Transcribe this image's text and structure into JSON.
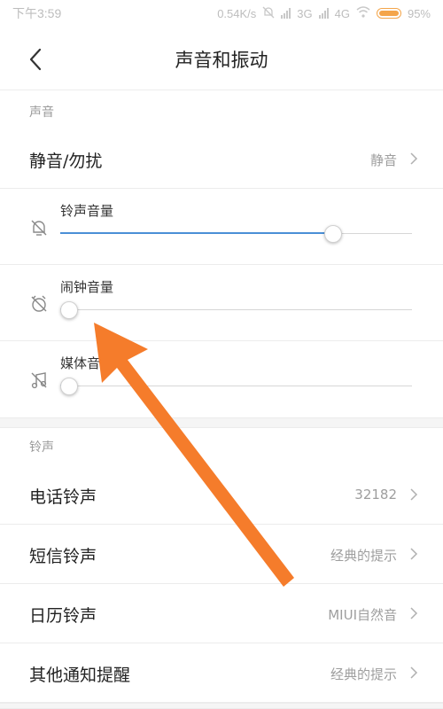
{
  "status_bar": {
    "time": "下午3:59",
    "network_speed": "0.54K/s",
    "network_3g": "3G",
    "network_4g": "4G",
    "battery": "95%",
    "icons": [
      "mute-icon",
      "signal-icon",
      "signal-icon",
      "wifi-icon",
      "battery-icon"
    ]
  },
  "header": {
    "title": "声音和振动",
    "back_icon": "chevron-left-icon"
  },
  "sound_section": {
    "header": "声音",
    "mute_row": {
      "label": "静音/勿扰",
      "value": "静音"
    },
    "volumes": [
      {
        "label": "铃声音量",
        "icon": "bell-muted-icon",
        "level": 0.79
      },
      {
        "label": "闹钟音量",
        "icon": "alarm-muted-icon",
        "level": 0.0
      },
      {
        "label": "媒体音量",
        "icon": "music-muted-icon",
        "level": 0.0
      }
    ]
  },
  "ringtone_section": {
    "header": "铃声",
    "items": [
      {
        "label": "电话铃声",
        "value": "32182"
      },
      {
        "label": "短信铃声",
        "value": "经典的提示"
      },
      {
        "label": "日历铃声",
        "value": "MIUI自然音"
      },
      {
        "label": "其他通知提醒",
        "value": "经典的提示"
      }
    ]
  },
  "colors": {
    "accent": "#4a8fd6",
    "annotation_arrow": "#f57c2b",
    "battery": "#f4a54a"
  }
}
